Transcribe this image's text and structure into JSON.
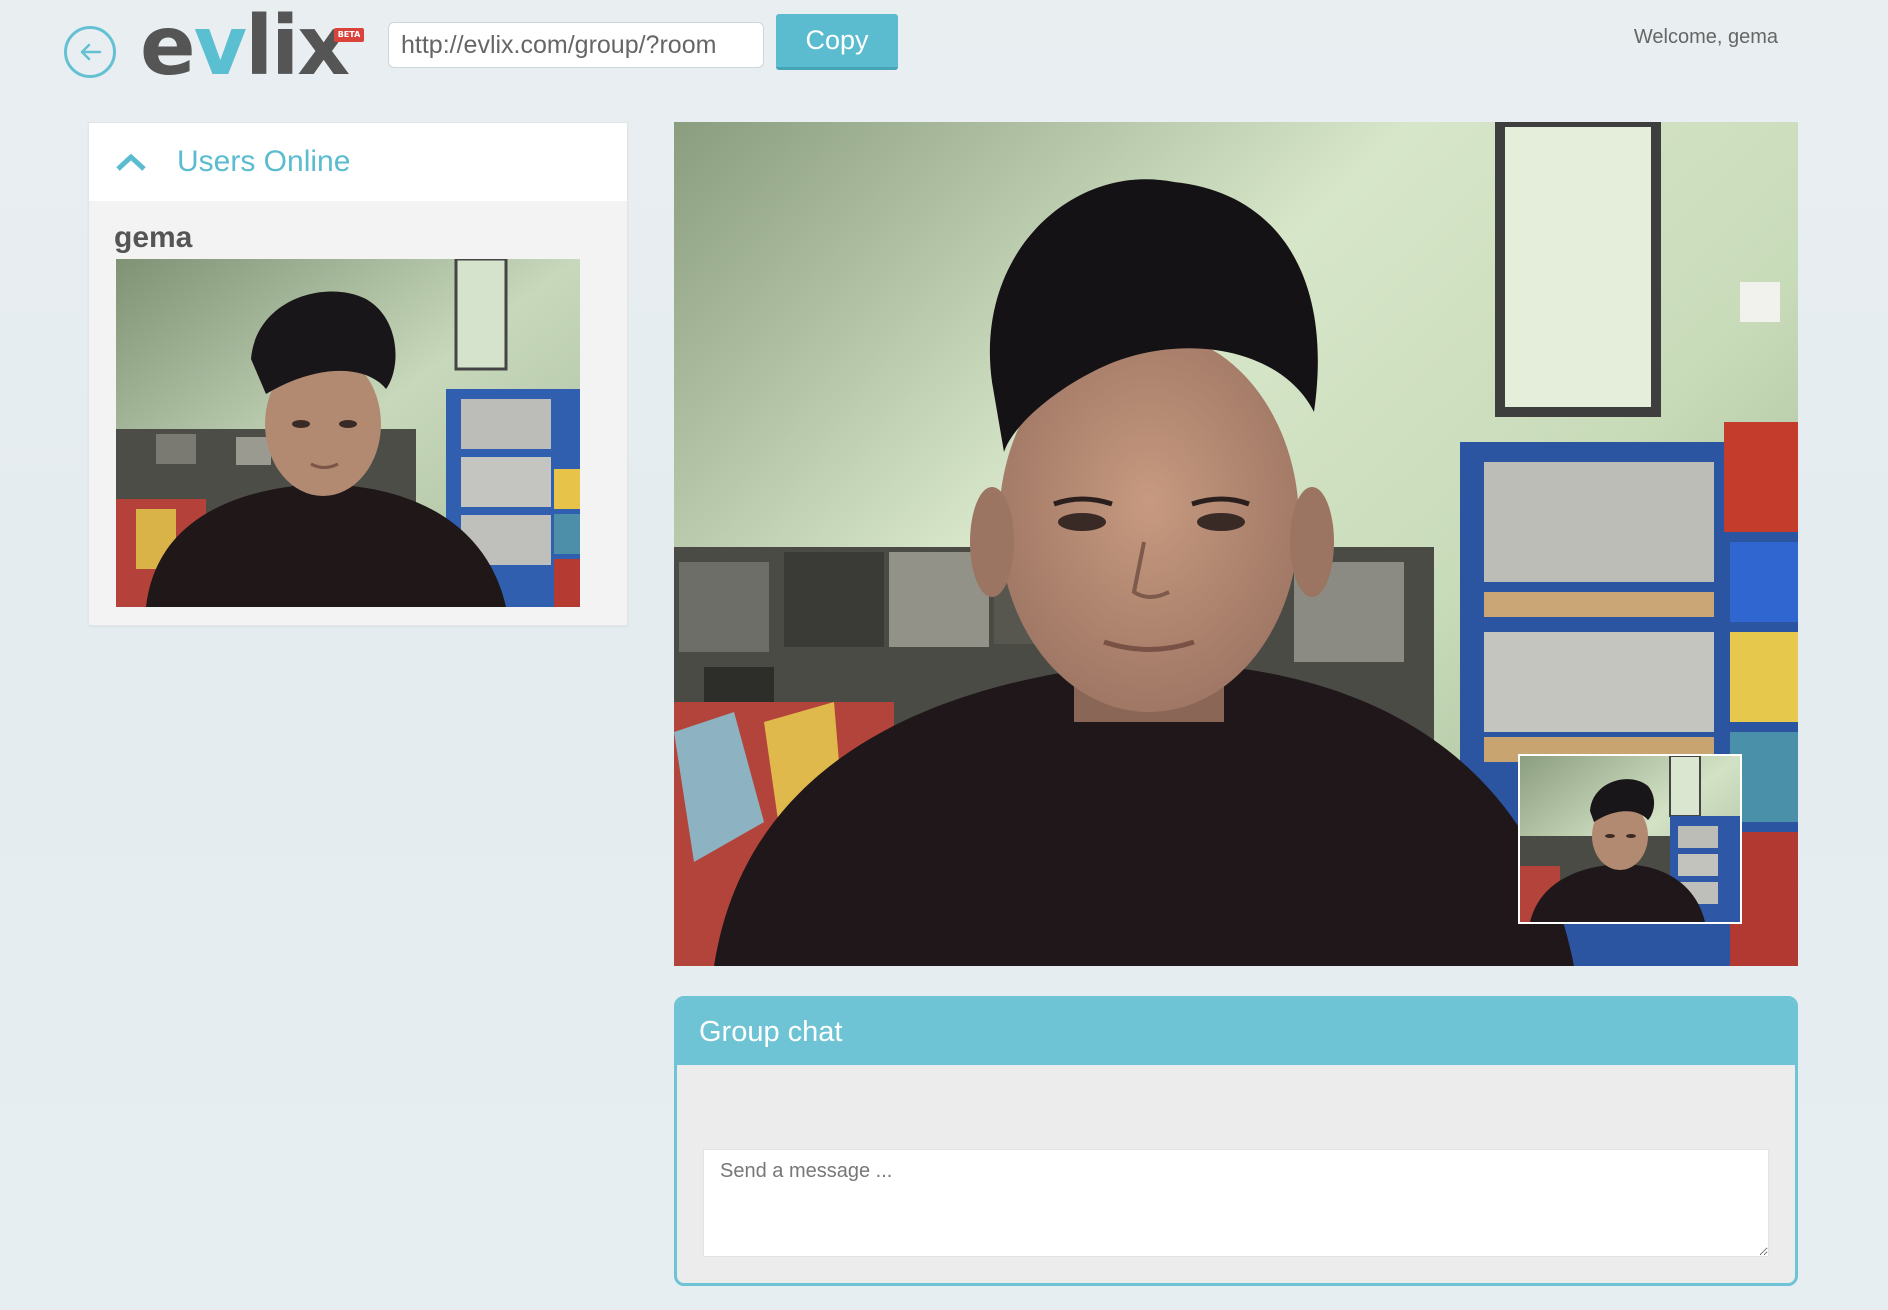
{
  "app": {
    "logo_prefix": "e",
    "logo_accent": "v",
    "logo_suffix": "lix",
    "badge": "BETA",
    "room_url": "http://evlix.com/group/?room",
    "copy_label": "Copy",
    "welcome_text": "Welcome, gema"
  },
  "sidebar": {
    "title": "Users Online",
    "users": [
      {
        "name": "gema"
      }
    ]
  },
  "chat": {
    "title": "Group chat",
    "placeholder": "Send a message ..."
  },
  "colors": {
    "accent": "#5bbcd0",
    "logo_text": "#555555",
    "badge": "#d9433b"
  },
  "icons": {
    "back": "back-arrow-icon",
    "collapse": "chevron-up-icon"
  }
}
